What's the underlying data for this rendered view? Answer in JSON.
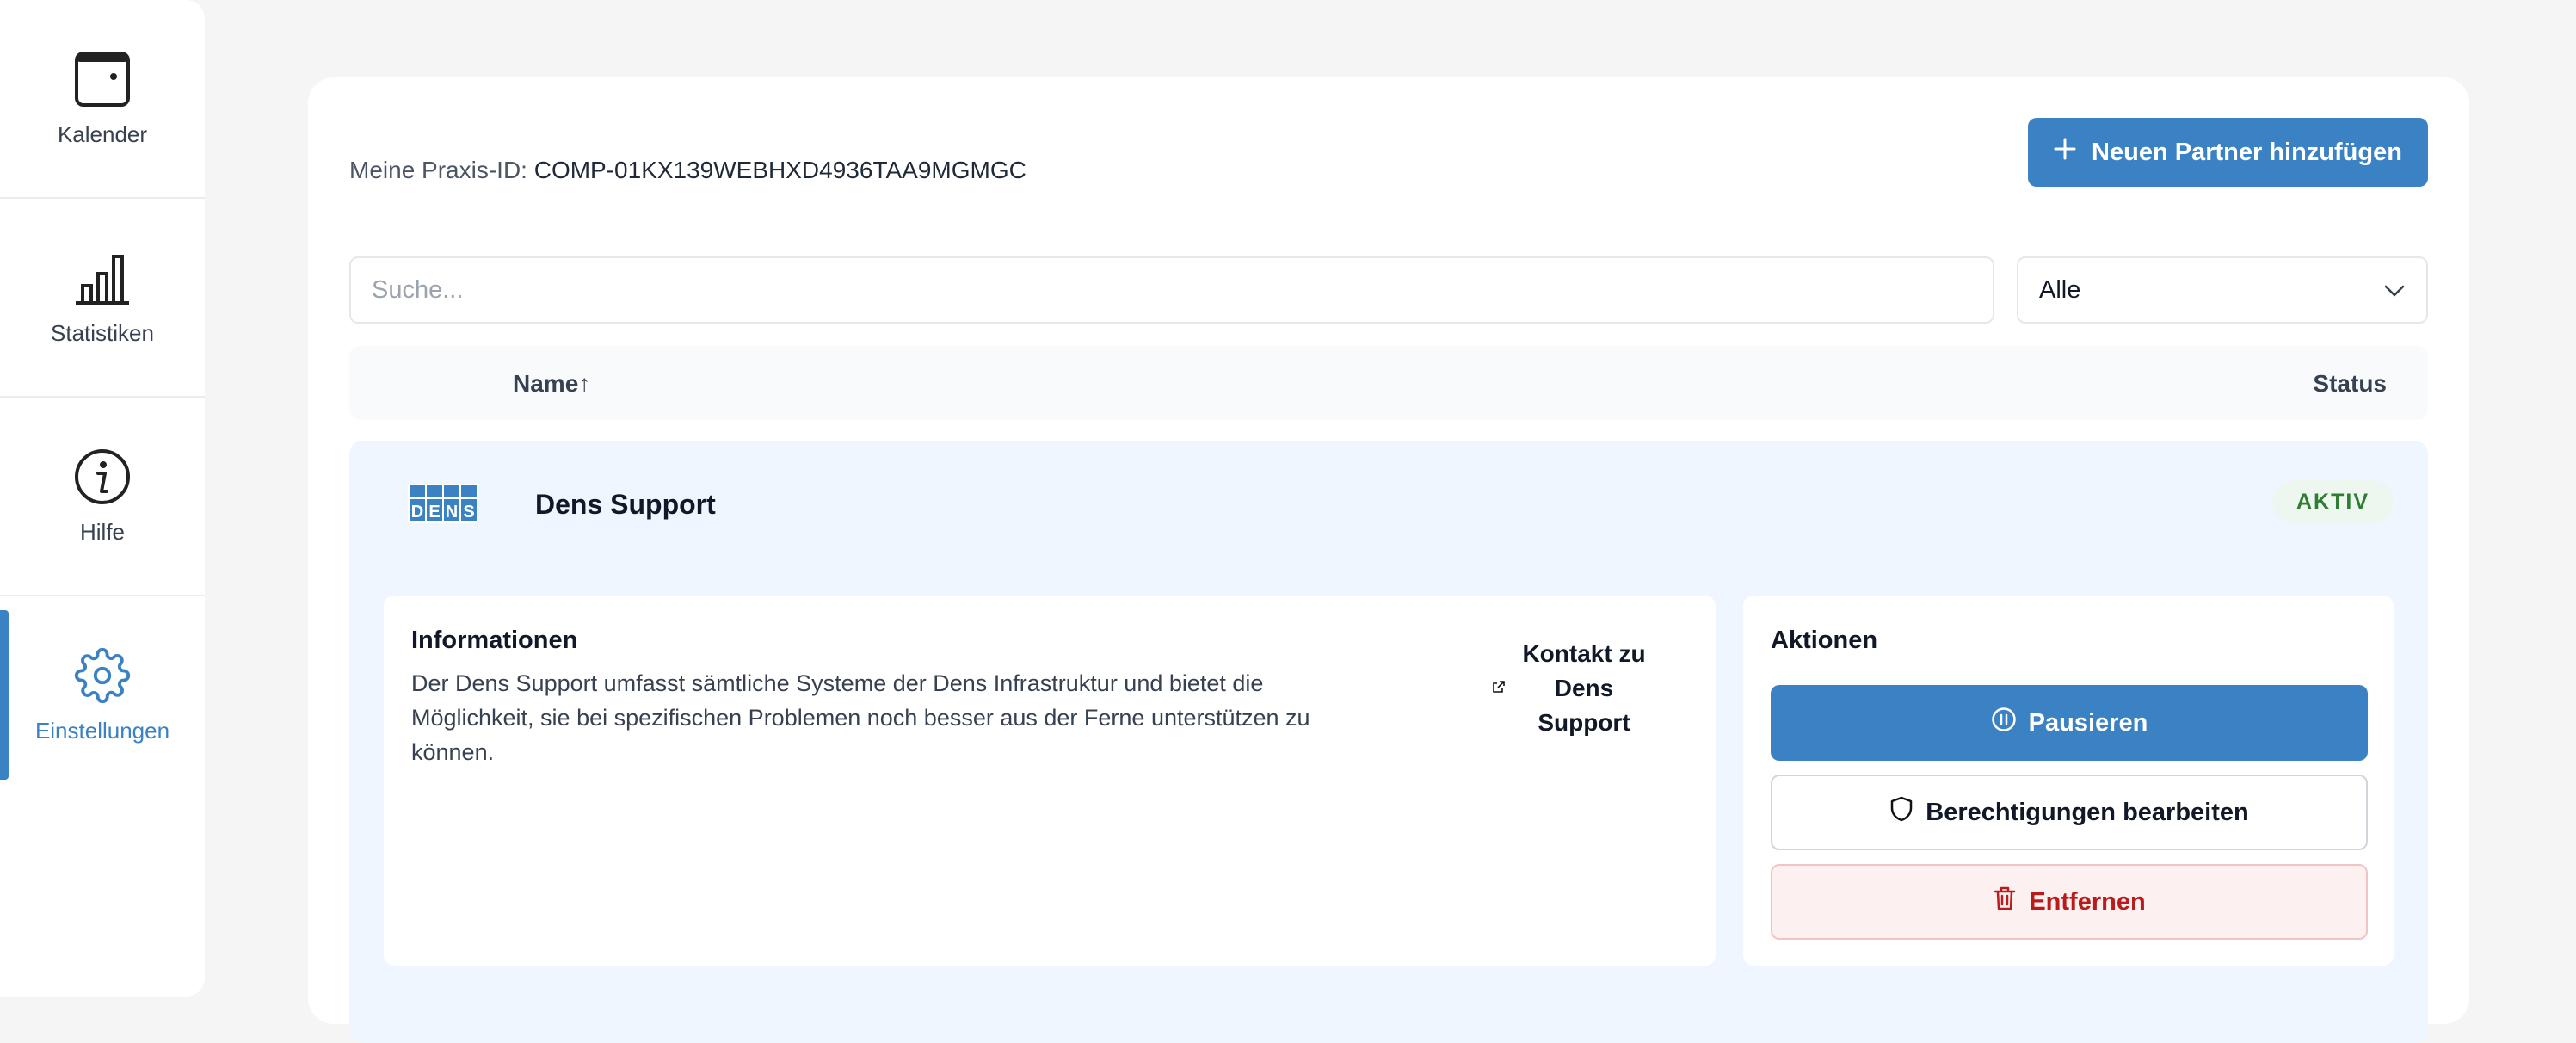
{
  "sidebar": {
    "items": [
      {
        "label": "Kalender",
        "icon": "calendar-icon",
        "active": false
      },
      {
        "label": "Statistiken",
        "icon": "bar-chart-icon",
        "active": false
      },
      {
        "label": "Hilfe",
        "icon": "info-icon",
        "active": false
      },
      {
        "label": "Einstellungen",
        "icon": "gear-icon",
        "active": true
      }
    ]
  },
  "header": {
    "praxis_label": "Meine Praxis-ID:",
    "praxis_id": "COMP-01KX139WEBHXD4936TAA9MGMGC",
    "add_button": "Neuen Partner hinzufügen"
  },
  "filters": {
    "search_placeholder": "Suche...",
    "search_value": "",
    "status_filter": "Alle"
  },
  "table": {
    "col_name": "Name↑",
    "col_status": "Status"
  },
  "partner": {
    "logo_text": "DENS",
    "name": "Dens Support",
    "status": "AKTIV",
    "info_title": "Informationen",
    "info_text": "Der Dens Support umfasst sämtliche Systeme der Dens Infrastruktur und bietet die Möglichkeit, sie bei spezifischen Problemen noch besser aus der Ferne unterstützen zu können.",
    "contact_label": "Kontakt zu Dens Support",
    "actions_title": "Aktionen",
    "pause_label": "Pausieren",
    "permissions_label": "Berechtigungen bearbeiten",
    "remove_label": "Entfernen"
  },
  "colors": {
    "accent": "#3b82c4",
    "active_badge_text": "#2e7d32",
    "danger": "#b91c1c"
  }
}
